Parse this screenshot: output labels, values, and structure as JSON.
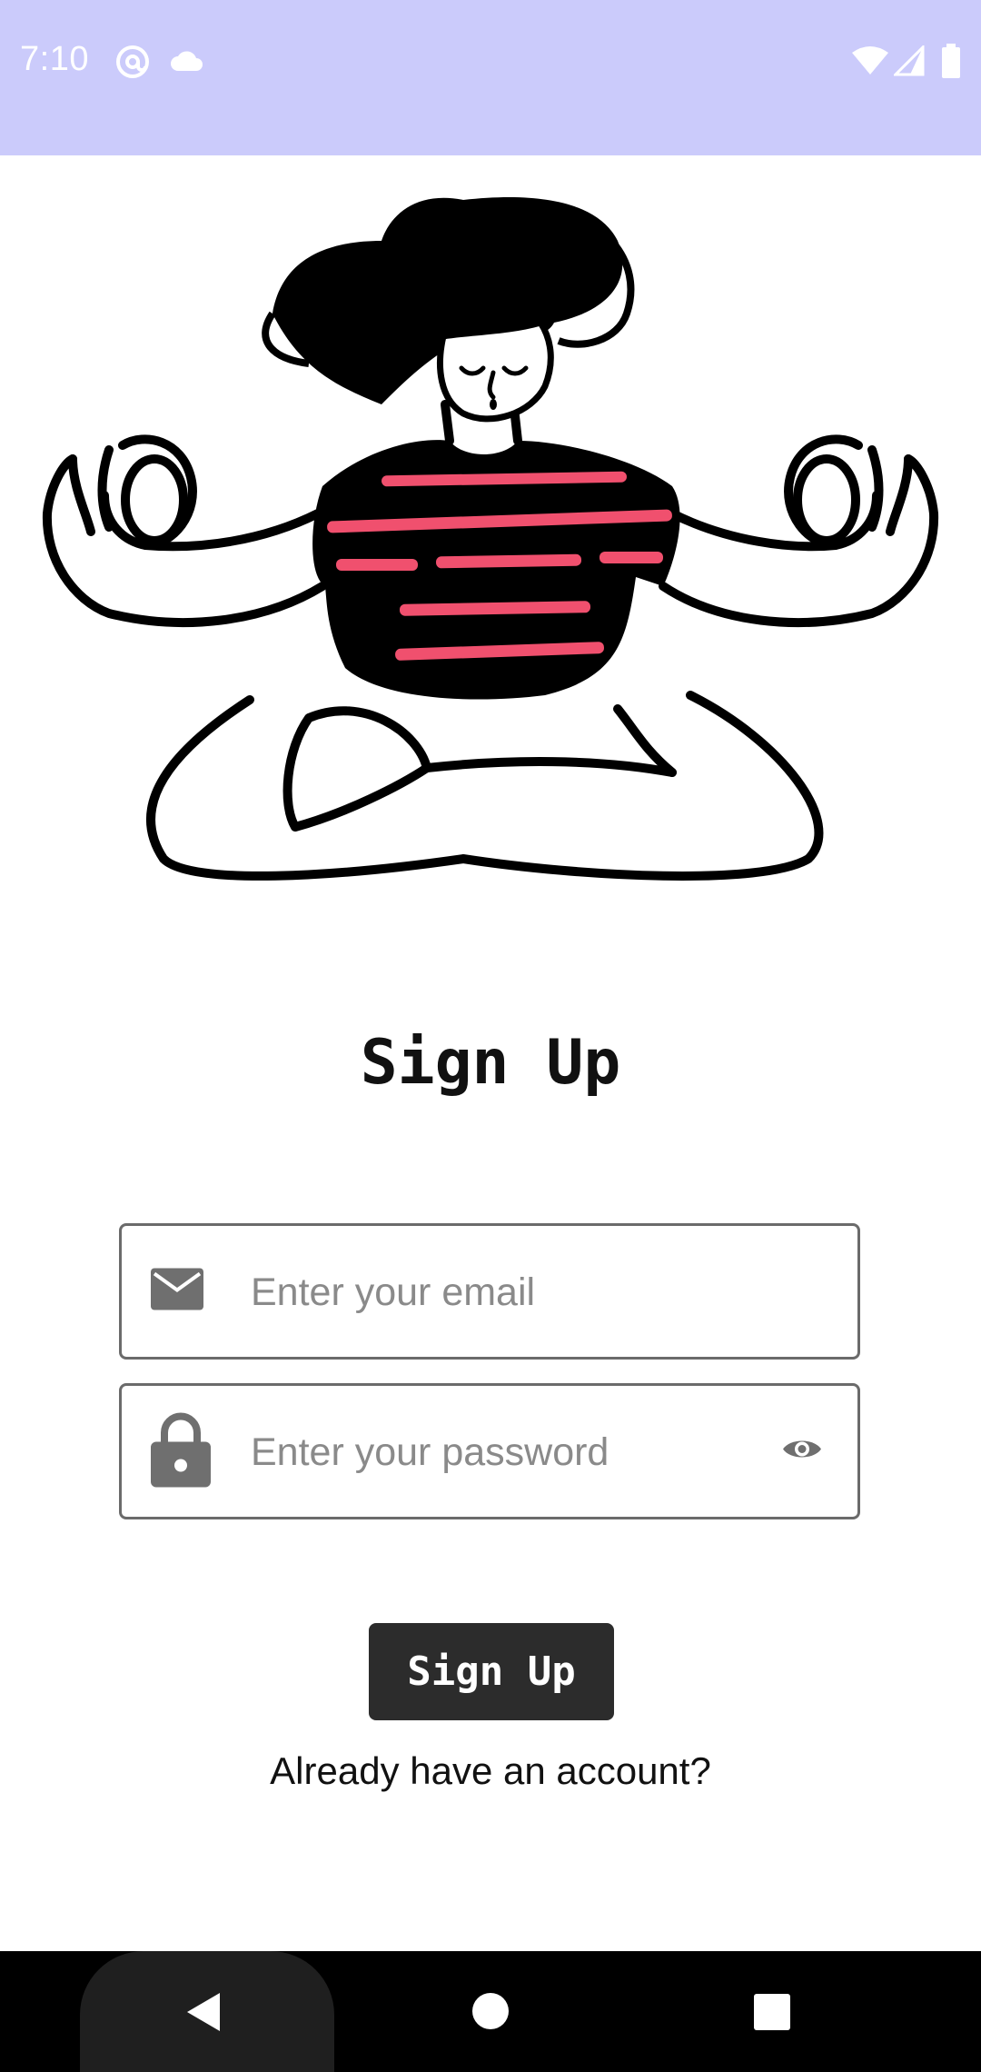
{
  "status_bar": {
    "time": "7:10",
    "icons": [
      "at-sign-icon",
      "cloud-icon",
      "wifi-icon",
      "signal-icon",
      "battery-icon"
    ]
  },
  "illustration": {
    "description_icon": "meditating-person-illustration",
    "stripe_color": "#f0506e"
  },
  "page": {
    "title": "Sign Up"
  },
  "form": {
    "email": {
      "icon": "envelope-icon",
      "placeholder": "Enter your email",
      "value": ""
    },
    "password": {
      "icon": "lock-icon",
      "placeholder": "Enter your password",
      "value": "",
      "toggle_icon": "eye-icon"
    },
    "submit_label": "Sign Up",
    "login_link": "Already have an account?"
  },
  "nav_bar": {
    "back_icon": "back-triangle-icon",
    "home_icon": "home-circle-icon",
    "recents_icon": "recents-square-icon"
  },
  "colors": {
    "status_bar": "#cbcbfb",
    "button_bg": "#2c2c2c",
    "border": "#6b6b6b"
  }
}
